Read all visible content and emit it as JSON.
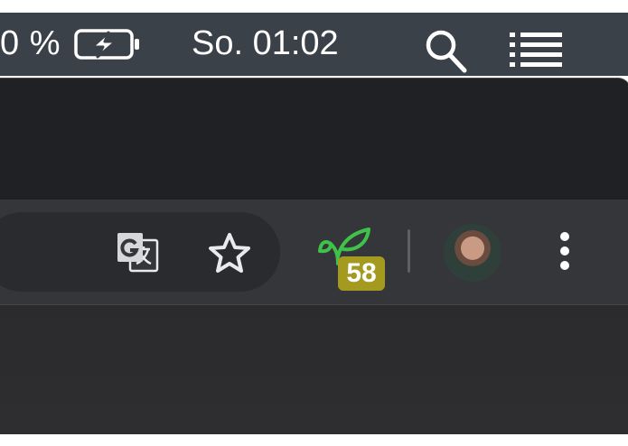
{
  "menubar": {
    "battery_percent": "0 %",
    "clock": "So. 01:02",
    "icons": [
      "battery-charging-icon",
      "search-icon",
      "control-center-list-icon"
    ]
  },
  "browser": {
    "toolbar": {
      "icons": [
        "translate-icon",
        "bookmark-star-icon",
        "extension-leaf-icon",
        "profile-avatar",
        "more-menu-icon"
      ],
      "extension_badge": "58"
    }
  },
  "colors": {
    "menubar_bg": "#3b4148",
    "tabstrip_bg": "#202124",
    "toolbar_bg": "#35363a",
    "badge_bg": "#a39a1f",
    "leaf_green": "#3ec24a"
  }
}
